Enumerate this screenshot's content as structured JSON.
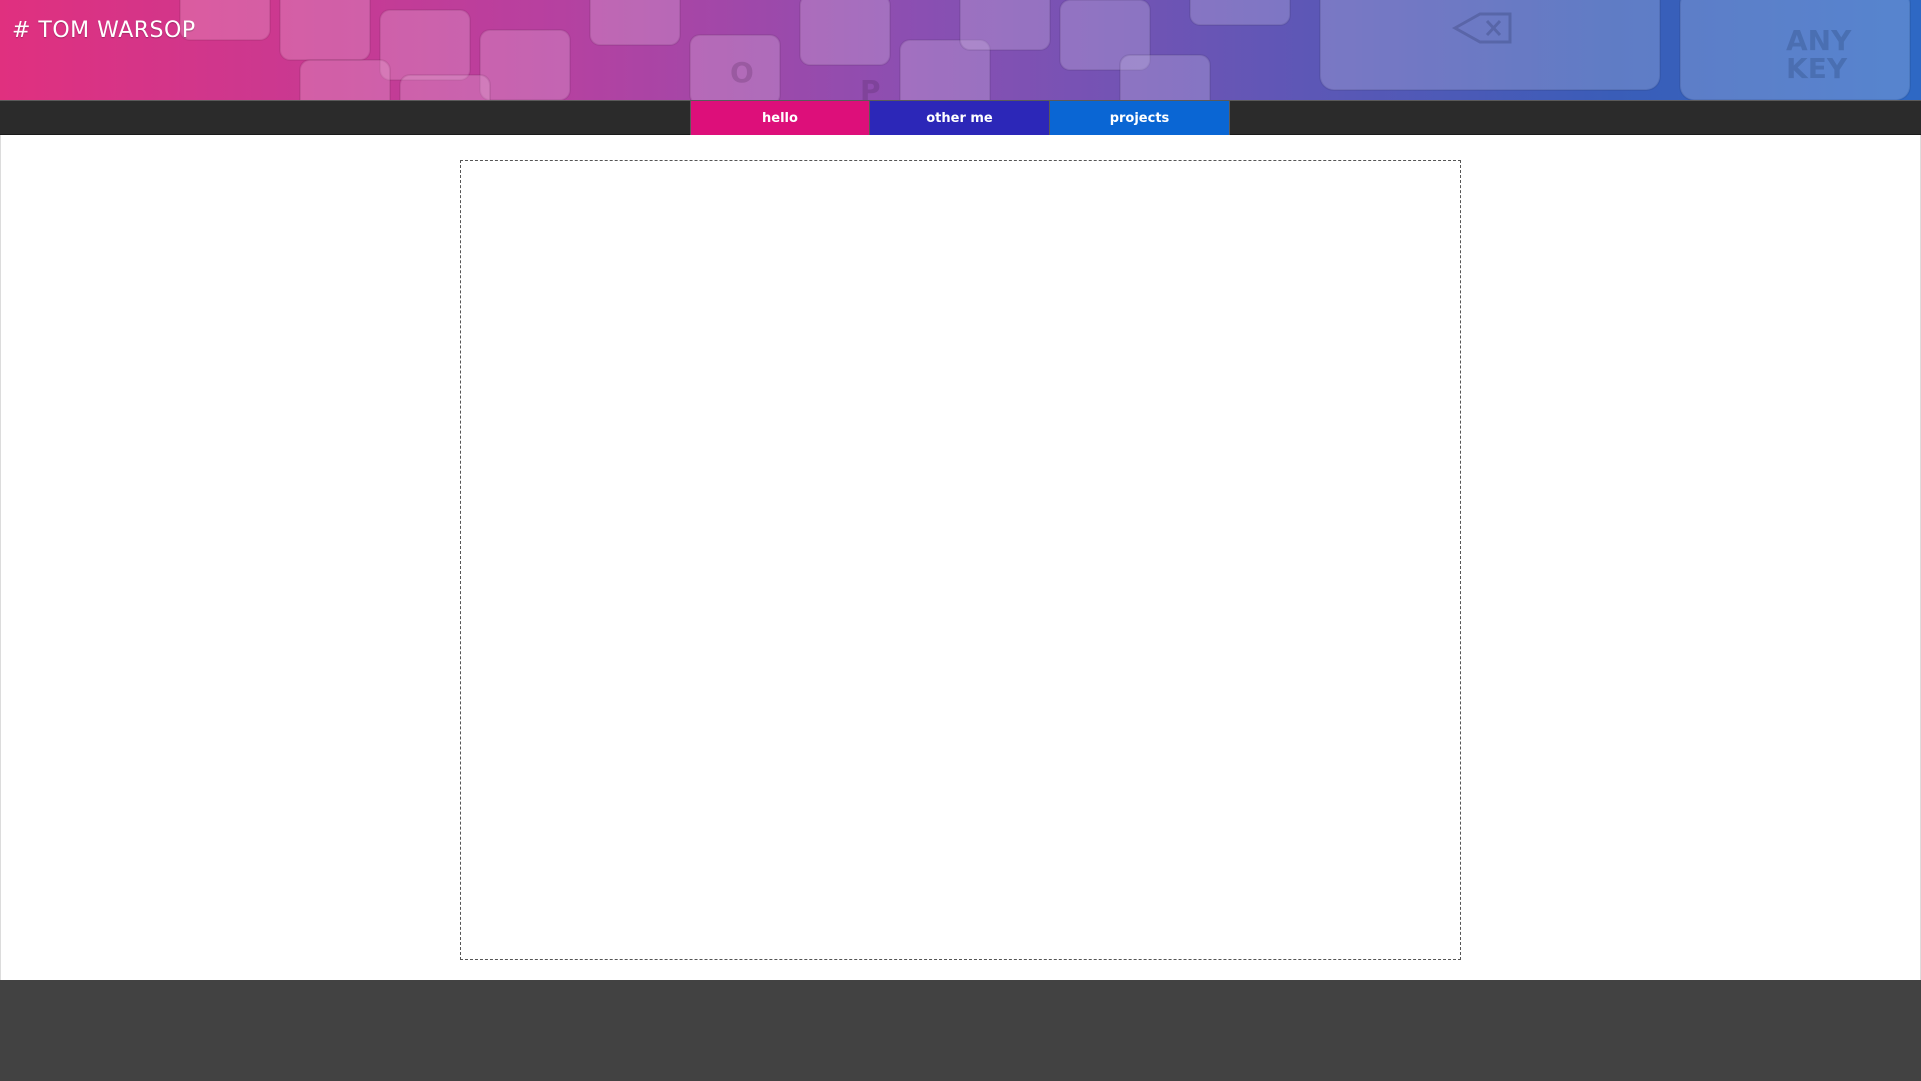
{
  "header": {
    "title": "# TOM WARSOP"
  },
  "nav": {
    "tabs": [
      {
        "label": "hello",
        "color": "#dd0f7a",
        "active": true
      },
      {
        "label": "other me",
        "color": "#2c27b8",
        "active": false
      },
      {
        "label": "projects",
        "color": "#0a66d4",
        "active": false
      }
    ]
  },
  "colors": {
    "navbar": "#2b2b2b",
    "footer": "#424242",
    "content_border": "#555555"
  }
}
